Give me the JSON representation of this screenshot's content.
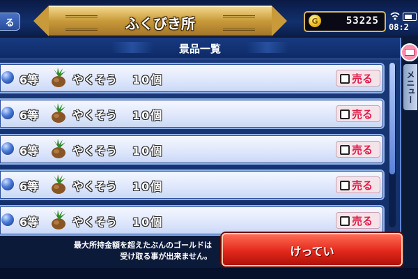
{
  "header": {
    "back_label": "る",
    "title": "ふくびき所",
    "gold": "53225",
    "clock": "08:2"
  },
  "panel": {
    "title": "景品一覧"
  },
  "prizes": [
    {
      "grade": "6等",
      "name": "やくそう",
      "qty": "10個",
      "sell_label": "売る"
    },
    {
      "grade": "6等",
      "name": "やくそう",
      "qty": "10個",
      "sell_label": "売る"
    },
    {
      "grade": "6等",
      "name": "やくそう",
      "qty": "10個",
      "sell_label": "売る"
    },
    {
      "grade": "6等",
      "name": "やくそう",
      "qty": "10個",
      "sell_label": "売る"
    },
    {
      "grade": "6等",
      "name": "やくそう",
      "qty": "10個",
      "sell_label": "売る"
    }
  ],
  "side": {
    "menu_label": "メニュー"
  },
  "footer": {
    "notice_line1": "最大所持金額を超えたぶんのゴールドは",
    "notice_line2": "受け取る事が出来ません。",
    "confirm_label": "けってい"
  },
  "icons": {
    "back": "back-button",
    "gold": "gold-coin-icon",
    "item": "herb-icon",
    "grade": "blue-orb-icon",
    "mail": "mail-icon"
  },
  "colors": {
    "sell_text": "#e01e4a",
    "confirm_button": "#e2281c",
    "title_gold": "#c99a3a"
  }
}
